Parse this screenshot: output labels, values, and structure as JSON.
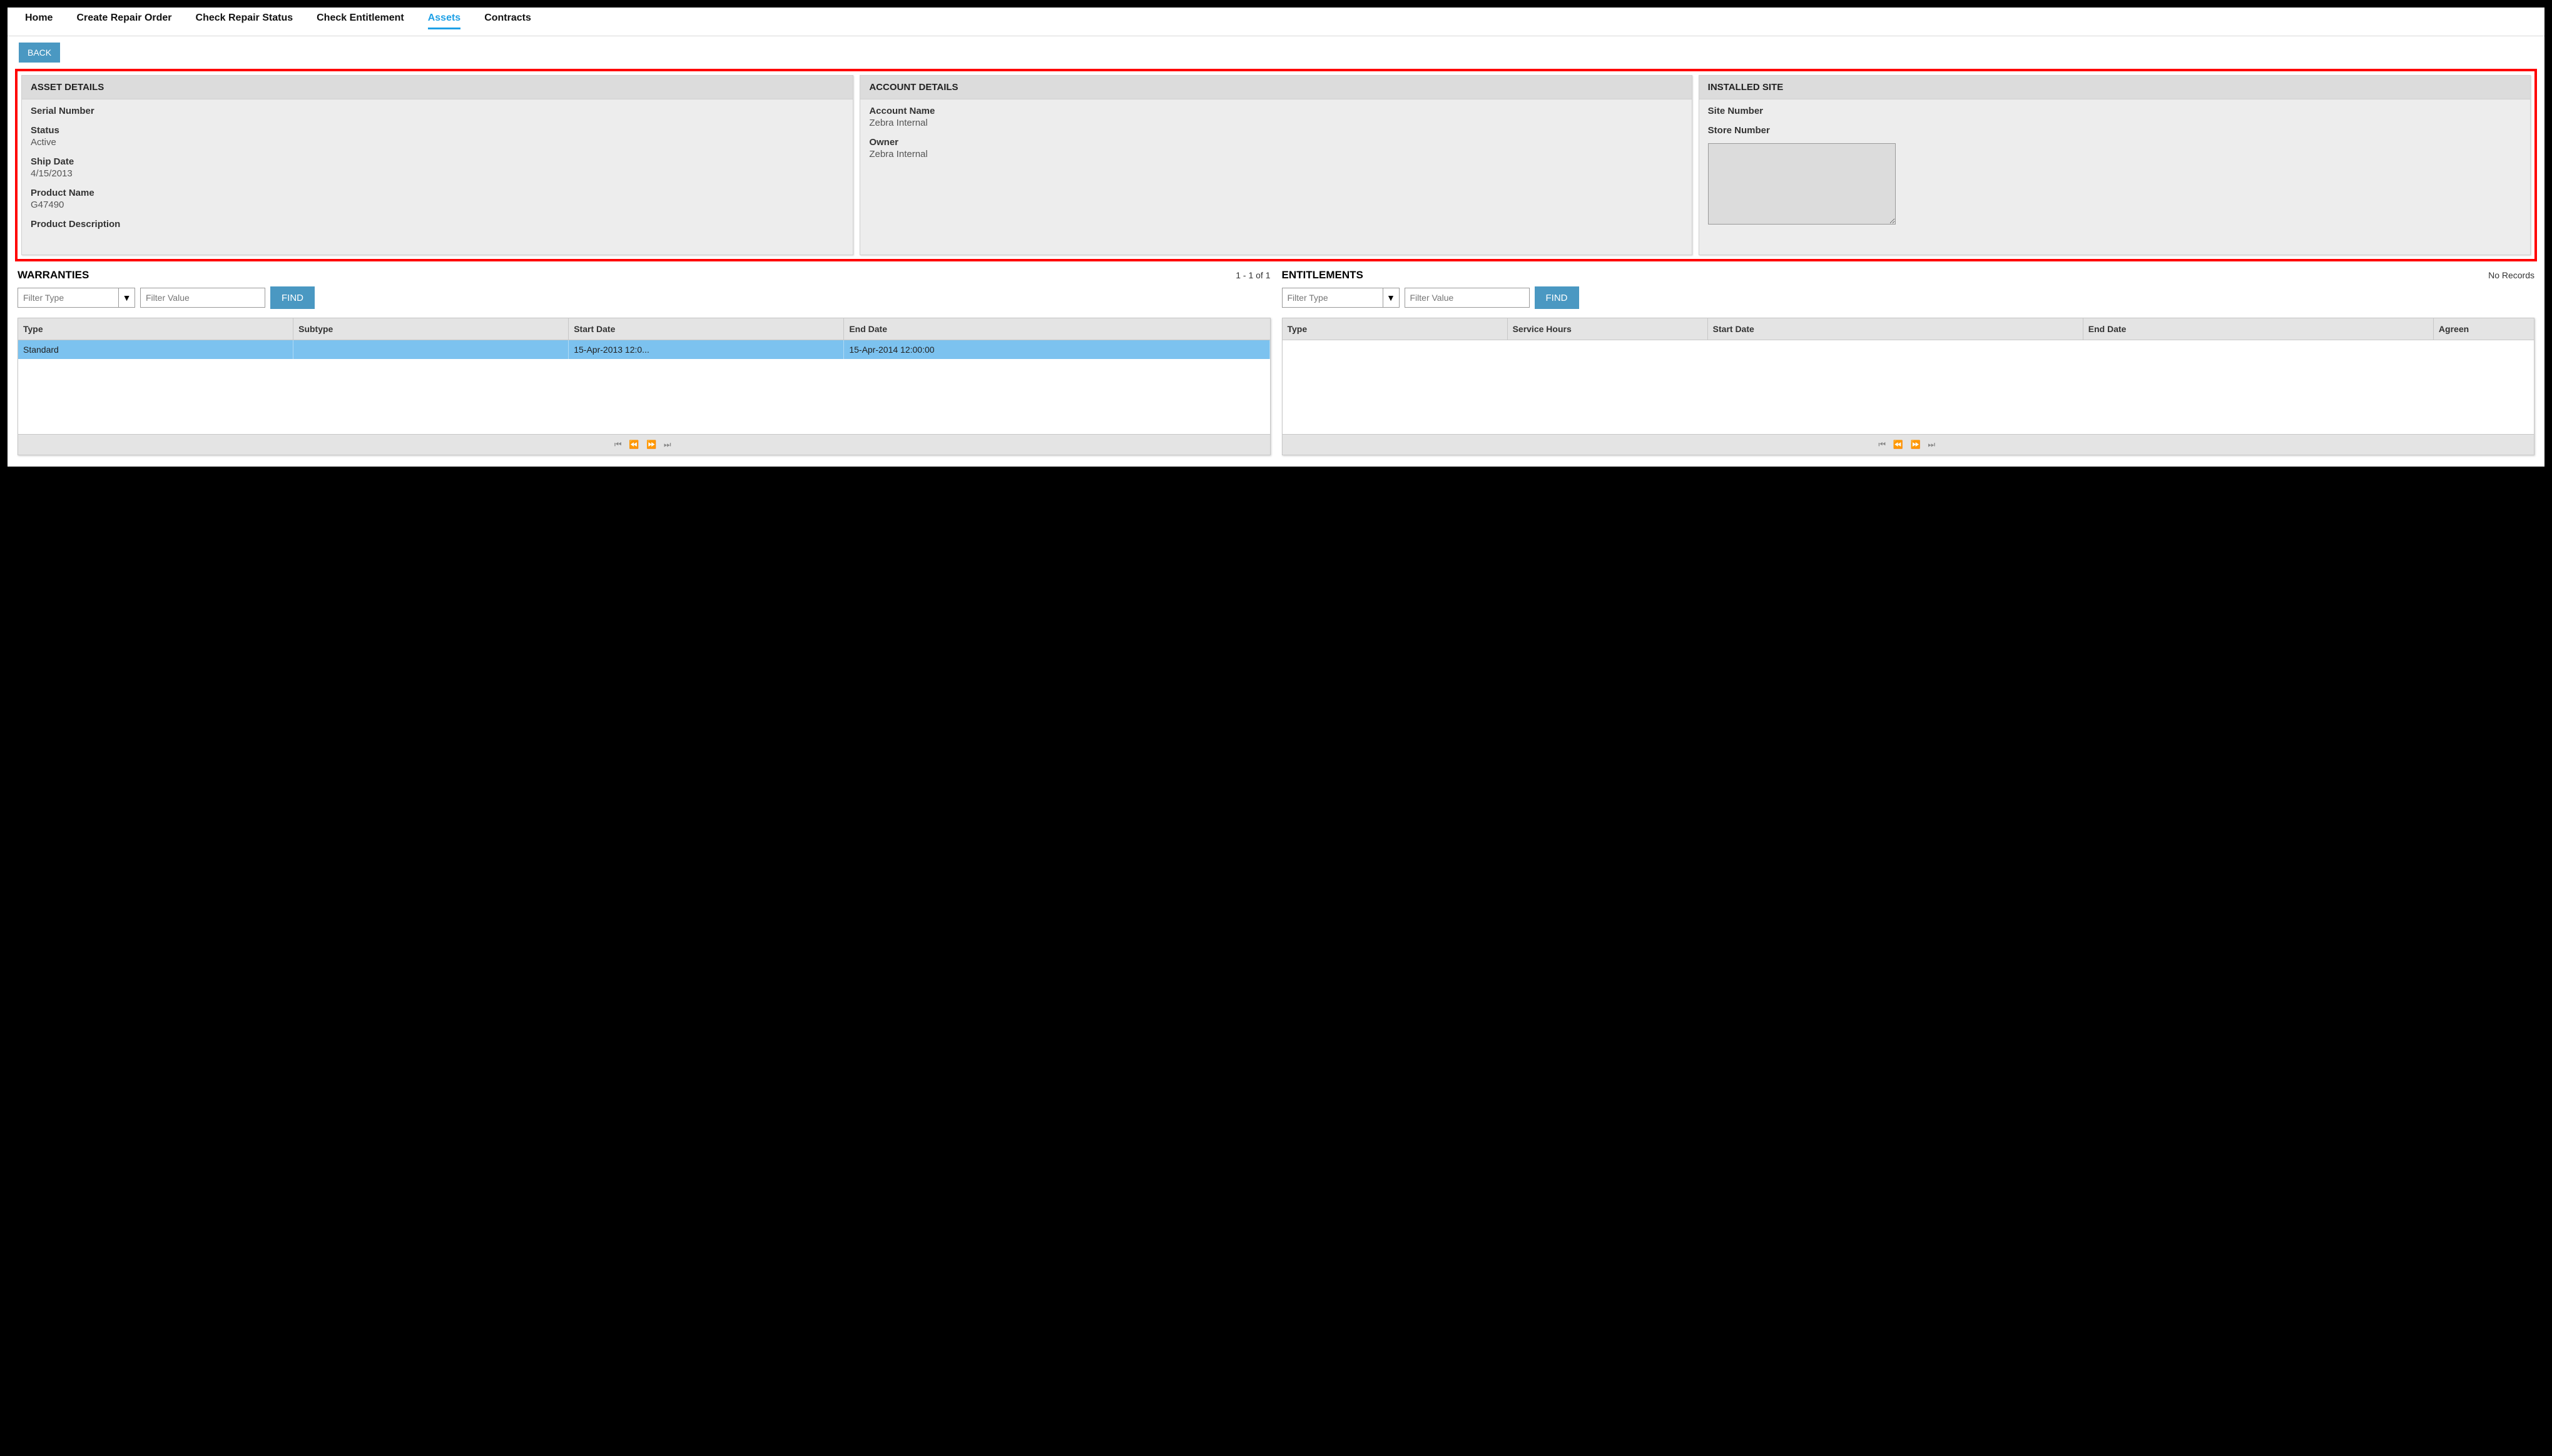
{
  "nav": {
    "items": [
      {
        "label": "Home",
        "active": false
      },
      {
        "label": "Create Repair Order",
        "active": false
      },
      {
        "label": "Check Repair Status",
        "active": false
      },
      {
        "label": "Check Entitlement",
        "active": false
      },
      {
        "label": "Assets",
        "active": true
      },
      {
        "label": "Contracts",
        "active": false
      }
    ]
  },
  "back_label": "BACK",
  "asset_details": {
    "title": "ASSET DETAILS",
    "serial_label": "Serial Number",
    "serial_value": "",
    "status_label": "Status",
    "status_value": "Active",
    "ship_label": "Ship Date",
    "ship_value": "4/15/2013",
    "product_name_label": "Product Name",
    "product_name_value": "G47490",
    "product_desc_label": "Product Description",
    "product_desc_value": ""
  },
  "account_details": {
    "title": "ACCOUNT DETAILS",
    "account_name_label": "Account Name",
    "account_name_value": "Zebra Internal",
    "owner_label": "Owner",
    "owner_value": "Zebra Internal"
  },
  "installed_site": {
    "title": "INSTALLED SITE",
    "site_number_label": "Site Number",
    "store_number_label": "Store Number",
    "textarea_value": ""
  },
  "warranties": {
    "title": "WARRANTIES",
    "count": "1 - 1 of 1",
    "filter_type_placeholder": "Filter Type",
    "filter_value_placeholder": "Filter Value",
    "find_label": "FIND",
    "headers": [
      "Type",
      "Subtype",
      "Start Date",
      "End Date"
    ],
    "rows": [
      {
        "type": "Standard",
        "subtype": "",
        "start": "15-Apr-2013 12:0...",
        "end": "15-Apr-2014 12:00:00"
      }
    ]
  },
  "entitlements": {
    "title": "ENTITLEMENTS",
    "count": "No Records",
    "filter_type_placeholder": "Filter Type",
    "filter_value_placeholder": "Filter Value",
    "find_label": "FIND",
    "headers": [
      "Type",
      "Service Hours",
      "Start Date",
      "End Date",
      "Agreen"
    ]
  },
  "chevron_down": "⌄"
}
